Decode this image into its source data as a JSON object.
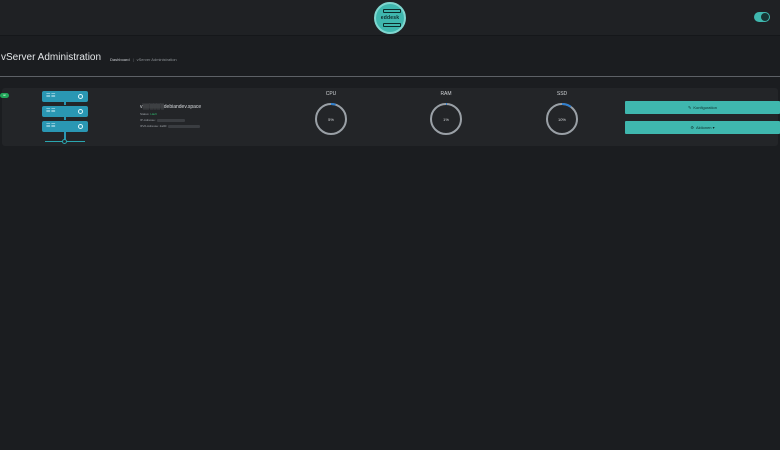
{
  "header": {
    "logo_text": "eddesk",
    "theme_toggle_on": true
  },
  "page": {
    "title": "vServer Administration",
    "breadcrumb": {
      "home": "Dashboard",
      "separator": "|",
      "current": "vServer Administration"
    }
  },
  "server": {
    "status_badge": "on",
    "name": "v░░░░░░debiandev.space",
    "state_label": "Status:",
    "state_value": "Läuft",
    "ipv4_label": "IP-Adresse:",
    "ipv6_label": "IPv6-Adresse: 2a00:"
  },
  "metrics": [
    {
      "label": "CPU",
      "value": 5,
      "display": "5%"
    },
    {
      "label": "RAM",
      "value": 1,
      "display": "1%"
    },
    {
      "label": "SSD",
      "value": 10,
      "display": "10%"
    }
  ],
  "actions": {
    "configure_label": "Konfiguration",
    "more_label": "Aktionen ▾"
  },
  "colors": {
    "accent": "#3fb7ae",
    "badge": "#22a65a",
    "gauge_track": "#9aa0a6",
    "gauge_fill": "#2d7fd0"
  }
}
